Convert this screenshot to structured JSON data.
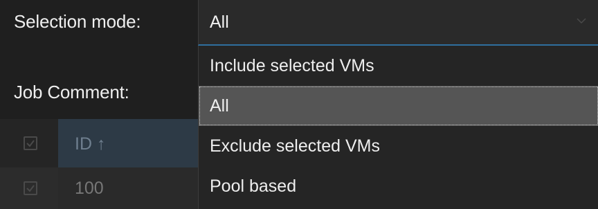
{
  "form": {
    "selection_mode_label": "Selection mode:",
    "job_comment_label": "Job Comment:"
  },
  "selection_combo": {
    "value": "All",
    "options": [
      {
        "label": "Include selected VMs",
        "selected": false
      },
      {
        "label": "All",
        "selected": true
      },
      {
        "label": "Exclude selected VMs",
        "selected": false
      },
      {
        "label": "Pool based",
        "selected": false
      }
    ]
  },
  "grid": {
    "id_header": "ID ↑",
    "rows": [
      {
        "id": "100"
      }
    ]
  },
  "icons": {
    "caret": "chevron-down-icon",
    "checkbox": "checkbox-icon"
  },
  "colors": {
    "background": "#1f1f1f",
    "selected_option": "#555555",
    "focus_underline": "#2f6f9f",
    "header_id_cell": "#2d3a46"
  }
}
